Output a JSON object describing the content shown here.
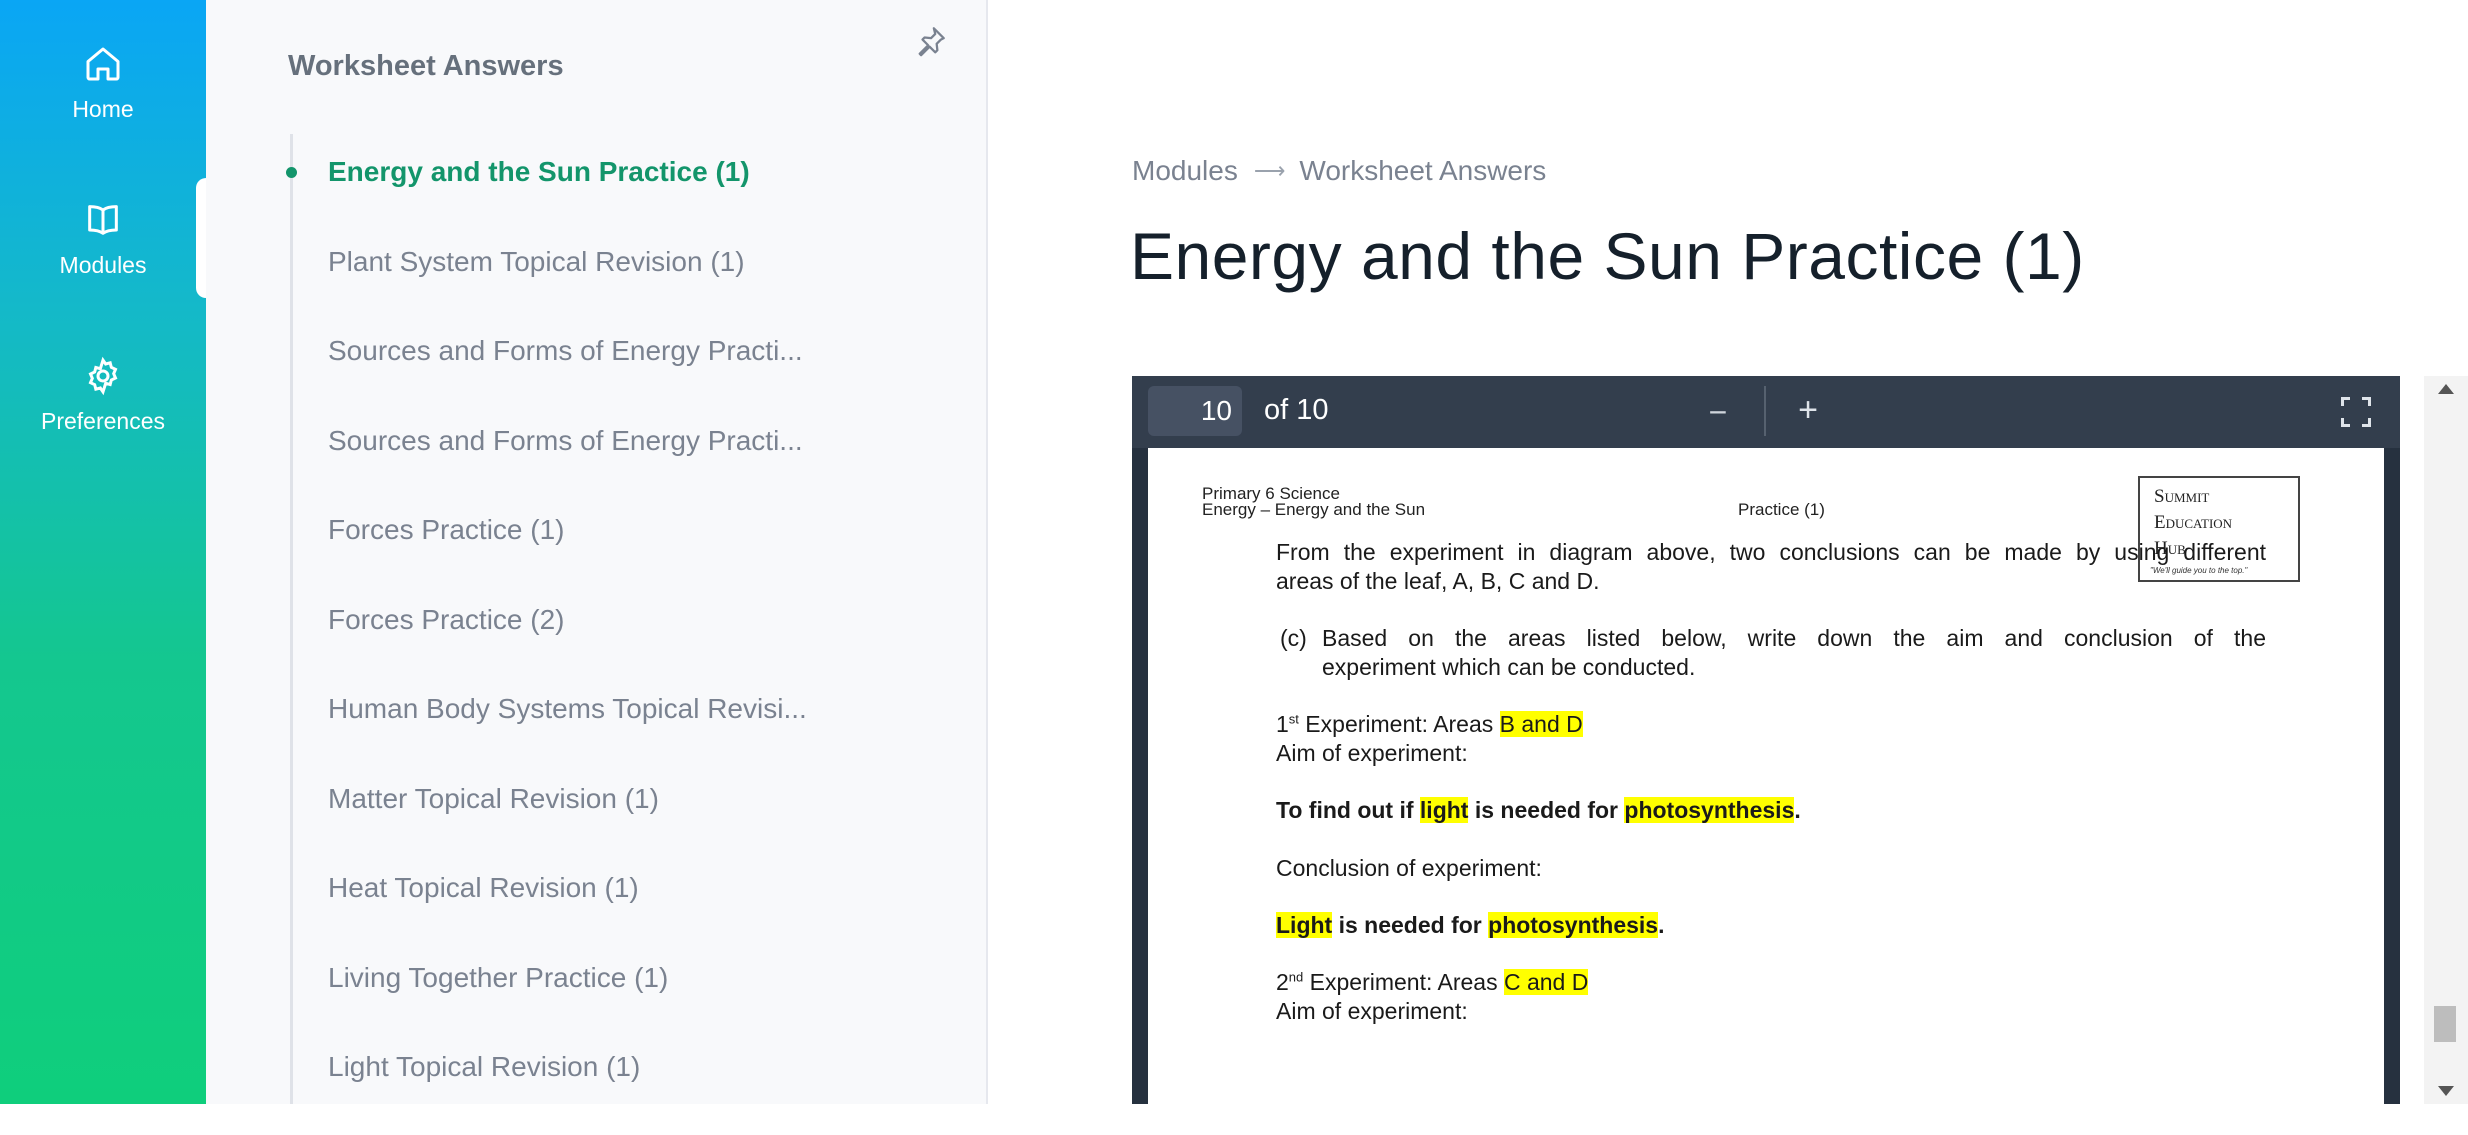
{
  "rail": {
    "items": [
      {
        "label": "Home",
        "icon": "home-icon"
      },
      {
        "label": "Modules",
        "icon": "book-icon"
      },
      {
        "label": "Preferences",
        "icon": "gear-icon"
      }
    ],
    "active": "Modules"
  },
  "sidebar": {
    "title": "Worksheet Answers",
    "items": [
      {
        "label": "Energy and the Sun Practice (1)"
      },
      {
        "label": "Plant System Topical Revision (1)"
      },
      {
        "label": "Sources and Forms of Energy Practi..."
      },
      {
        "label": "Sources and Forms of Energy Practi..."
      },
      {
        "label": "Forces Practice (1)"
      },
      {
        "label": "Forces Practice (2)"
      },
      {
        "label": "Human Body Systems Topical Revisi..."
      },
      {
        "label": "Matter Topical Revision (1)"
      },
      {
        "label": "Heat Topical Revision (1)"
      },
      {
        "label": "Living Together Practice (1)"
      },
      {
        "label": "Light Topical Revision (1)"
      }
    ],
    "active_index": 0
  },
  "breadcrumb": {
    "first": "Modules",
    "separator": "⟶",
    "second": "Worksheet Answers"
  },
  "page_title": "Energy and the Sun Practice (1)",
  "viewer": {
    "page_number": "10",
    "page_total": "of 10",
    "zoom_out": "−",
    "zoom_in": "+"
  },
  "document": {
    "header_subject": "Primary 6 Science",
    "header_topic": "Energy – Energy and the Sun",
    "header_practice": "Practice (1)",
    "logo": {
      "line1": "Summit",
      "line2": "Education",
      "line3": "Hub",
      "tagline": "\"We'll guide you to the top.\""
    },
    "intro_line1": "From the experiment in diagram above, two conclusions can be made by using different",
    "intro_line2": "areas of the leaf, A, B, C and D.",
    "question_label": "(c)",
    "question_line1": "Based on the areas listed below, write down the aim and conclusion of the",
    "question_line2": "experiment which can be conducted.",
    "exp1_num": "1",
    "exp1_sup": "st",
    "exp1_text": " Experiment: Areas ",
    "exp1_areas": "B and D",
    "aim_label": "Aim of experiment:",
    "aim1_part1": "To find out if ",
    "aim1_hl1": "light",
    "aim1_part2": " is needed for ",
    "aim1_hl2": "photosynthesis",
    "aim1_end": ".",
    "conclusion_label": "Conclusion of experiment:",
    "conc1_hl1": "Light",
    "conc1_part": " is needed for ",
    "conc1_hl2": "photosynthesis",
    "conc1_end": ".",
    "exp2_num": "2",
    "exp2_sup": "nd",
    "exp2_text": " Experiment: Areas ",
    "exp2_areas": "C and D",
    "aim2_label": "Aim of experiment:"
  },
  "colors": {
    "active": "#13956b",
    "highlight": "#ffff00",
    "rail_top": "#0aa6f5",
    "rail_bottom": "#0fce7c"
  }
}
